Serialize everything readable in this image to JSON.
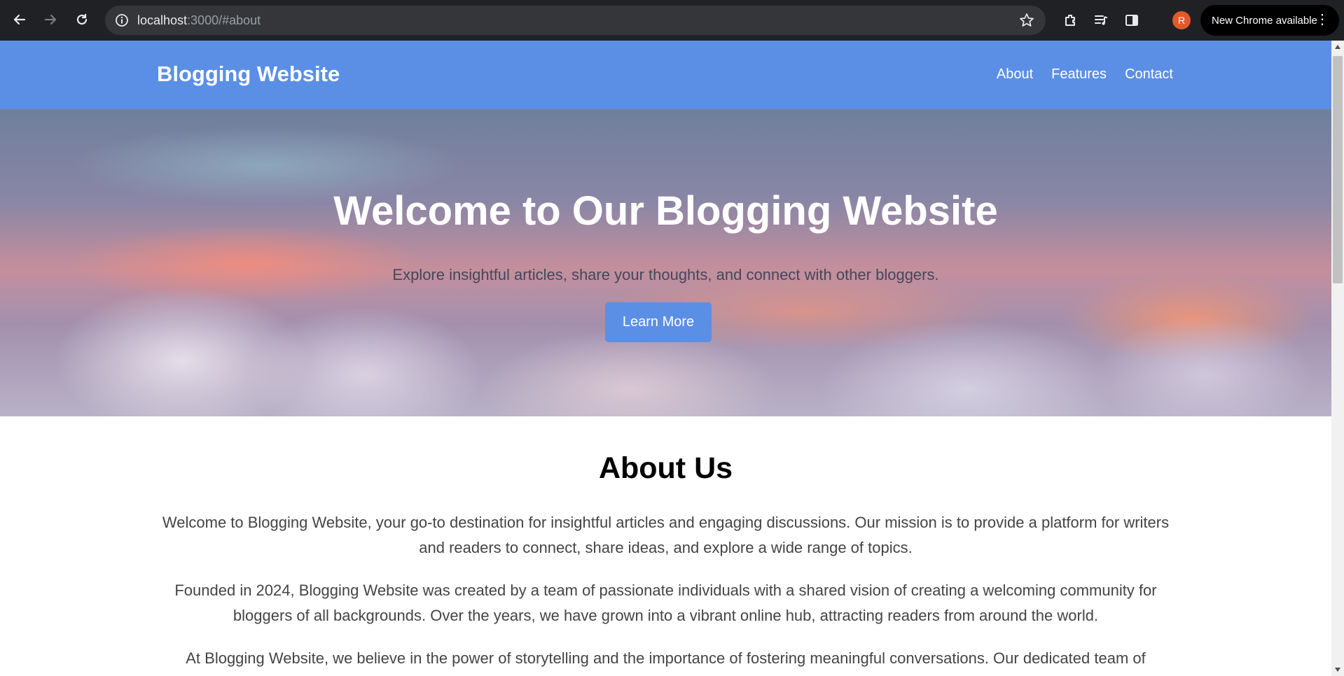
{
  "browser": {
    "url_host": "localhost",
    "url_rest": ":3000/#about",
    "update_label": "New Chrome available",
    "profile_initial": "R"
  },
  "site": {
    "brand": "Blogging Website",
    "nav": [
      {
        "label": "About"
      },
      {
        "label": "Features"
      },
      {
        "label": "Contact"
      }
    ]
  },
  "hero": {
    "title": "Welcome to Our Blogging Website",
    "subtitle": "Explore insightful articles, share your thoughts, and connect with other bloggers.",
    "button": "Learn More"
  },
  "about": {
    "title": "About Us",
    "paragraphs": [
      "Welcome to Blogging Website, your go-to destination for insightful articles and engaging discussions. Our mission is to provide a platform for writers and readers to connect, share ideas, and explore a wide range of topics.",
      "Founded in 2024, Blogging Website was created by a team of passionate individuals with a shared vision of creating a welcoming community for bloggers of all backgrounds. Over the years, we have grown into a vibrant online hub, attracting readers from around the world.",
      "At Blogging Website, we believe in the power of storytelling and the importance of fostering meaningful conversations. Our dedicated team of"
    ]
  },
  "colors": {
    "brand_blue": "#5b8fe6",
    "chrome_dark": "#202124"
  }
}
